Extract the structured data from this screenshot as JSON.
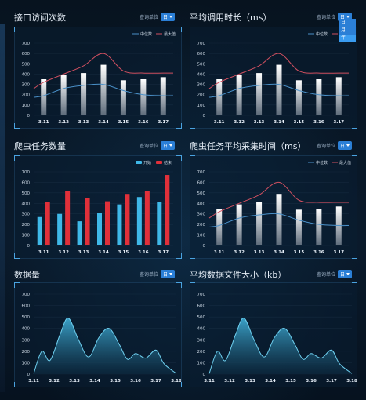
{
  "query_label": "查询单位",
  "unit_selected": "日",
  "unit_options": [
    "日",
    "月",
    "年"
  ],
  "panels": [
    {
      "title": "接口访问次数"
    },
    {
      "title": "平均调用时长（ms）"
    },
    {
      "title": "爬虫任务数量"
    },
    {
      "title": "爬虫任务平均采集时间（ms）"
    },
    {
      "title": "数据量"
    },
    {
      "title": "平均数据文件大小（kb）"
    }
  ],
  "colors": {
    "accent": "#2b7fd6",
    "median": "#4a90c8",
    "max": "#d05060",
    "bar_start": "#3fb8e8",
    "bar_end": "#e0303a",
    "area": "#3da8d0"
  },
  "chart_data": [
    {
      "type": "bar",
      "title": "",
      "categories": [
        "3.11",
        "3.12",
        "3.13",
        "3.14",
        "3.15",
        "3.16",
        "3.17"
      ],
      "ylim": [
        0,
        700
      ],
      "yticks": [
        0,
        100,
        200,
        300,
        400,
        500,
        600,
        700
      ],
      "series": [
        {
          "name": "",
          "values": [
            350,
            390,
            410,
            490,
            340,
            350,
            370
          ]
        }
      ],
      "lines": [
        {
          "name": "中位数",
          "values": [
            190,
            260,
            290,
            300,
            240,
            200,
            190
          ]
        },
        {
          "name": "最大值",
          "values": [
            320,
            400,
            480,
            600,
            430,
            410,
            410
          ]
        }
      ]
    },
    {
      "type": "bar",
      "title": "",
      "categories": [
        "3.11",
        "3.12",
        "3.13",
        "3.14",
        "3.15",
        "3.16",
        "3.17"
      ],
      "ylim": [
        0,
        700
      ],
      "yticks": [
        0,
        100,
        200,
        300,
        400,
        500,
        600,
        700
      ],
      "series": [
        {
          "name": "",
          "values": [
            350,
            390,
            410,
            490,
            340,
            350,
            370
          ]
        }
      ],
      "lines": [
        {
          "name": "中位数",
          "values": [
            190,
            260,
            290,
            300,
            240,
            200,
            190
          ]
        },
        {
          "name": "最大值",
          "values": [
            320,
            400,
            480,
            600,
            430,
            410,
            410
          ]
        }
      ]
    },
    {
      "type": "bar",
      "title": "",
      "categories": [
        "3.11",
        "3.12",
        "3.13",
        "3.14",
        "3.15",
        "3.16",
        "3.17"
      ],
      "ylim": [
        0,
        700
      ],
      "yticks": [
        0,
        100,
        200,
        300,
        400,
        500,
        600,
        700
      ],
      "series": [
        {
          "name": "开始",
          "values": [
            270,
            300,
            230,
            310,
            390,
            460,
            410
          ]
        },
        {
          "name": "结束",
          "values": [
            410,
            520,
            450,
            420,
            490,
            520,
            670
          ]
        }
      ]
    },
    {
      "type": "bar",
      "title": "",
      "categories": [
        "3.11",
        "3.12",
        "3.13",
        "3.14",
        "3.15",
        "3.16",
        "3.17"
      ],
      "ylim": [
        0,
        700
      ],
      "yticks": [
        0,
        100,
        200,
        300,
        400,
        500,
        600,
        700
      ],
      "series": [
        {
          "name": "",
          "values": [
            350,
            390,
            410,
            490,
            340,
            350,
            370
          ]
        }
      ],
      "lines": [
        {
          "name": "中位数",
          "values": [
            190,
            260,
            290,
            300,
            240,
            200,
            190
          ]
        },
        {
          "name": "最大值",
          "values": [
            320,
            400,
            480,
            600,
            430,
            410,
            410
          ]
        }
      ]
    },
    {
      "type": "area",
      "title": "",
      "categories": [
        "3.11",
        "3.12",
        "3.13",
        "3.14",
        "3.15",
        "3.16",
        "3.17",
        "3.18"
      ],
      "ylim": [
        0,
        700
      ],
      "yticks": [
        0,
        100,
        200,
        300,
        400,
        500,
        600,
        700
      ],
      "x": [
        0,
        0.4,
        0.8,
        1.3,
        1.7,
        2.2,
        2.7,
        3.2,
        3.7,
        4.2,
        4.6,
        5.0,
        5.5,
        6.0,
        6.4,
        7.0
      ],
      "values": [
        5,
        200,
        120,
        350,
        490,
        300,
        150,
        320,
        400,
        260,
        130,
        180,
        140,
        210,
        90,
        5
      ]
    },
    {
      "type": "area",
      "title": "",
      "categories": [
        "3.11",
        "3.12",
        "3.13",
        "3.14",
        "3.15",
        "3.16",
        "3.17",
        "3.18"
      ],
      "ylim": [
        0,
        700
      ],
      "yticks": [
        0,
        100,
        200,
        300,
        400,
        500,
        600,
        700
      ],
      "x": [
        0,
        0.4,
        0.8,
        1.3,
        1.7,
        2.2,
        2.7,
        3.2,
        3.7,
        4.2,
        4.6,
        5.0,
        5.5,
        6.0,
        6.4,
        7.0
      ],
      "values": [
        5,
        200,
        120,
        350,
        490,
        300,
        150,
        320,
        400,
        260,
        130,
        180,
        140,
        210,
        90,
        5
      ]
    }
  ]
}
